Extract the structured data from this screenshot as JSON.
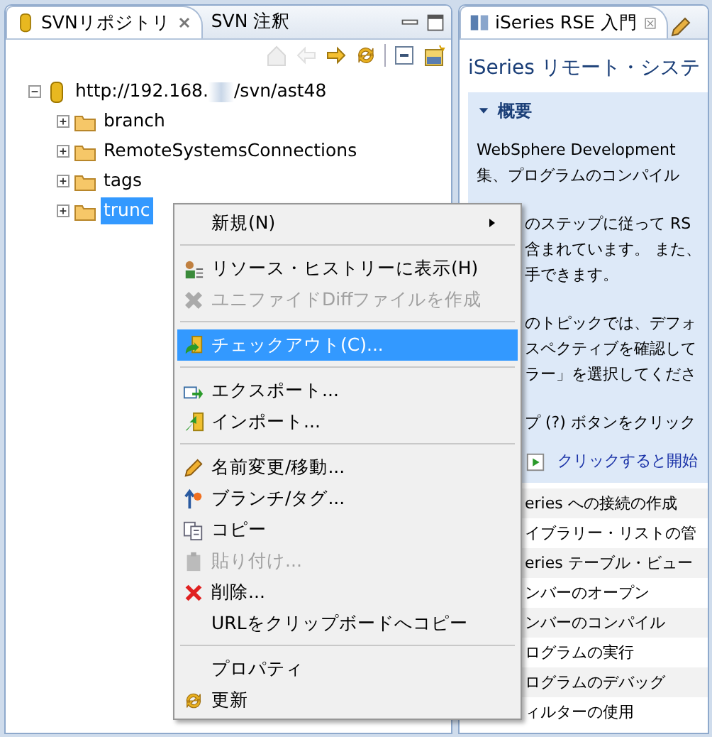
{
  "left_panel": {
    "tabs": [
      {
        "label": "SVNリポジトリ",
        "selected": true,
        "closable": true
      },
      {
        "label": "SVN 注釈",
        "selected": false,
        "closable": false
      }
    ],
    "toolbar": [
      {
        "kind": "home",
        "disabled": true
      },
      {
        "kind": "back",
        "disabled": true
      },
      {
        "kind": "forward",
        "disabled": false
      },
      {
        "kind": "sync",
        "disabled": false
      },
      {
        "kind": "sep"
      },
      {
        "kind": "collapse",
        "disabled": false
      },
      {
        "kind": "svn-new",
        "disabled": false
      }
    ],
    "tree": [
      {
        "label_start": "http://192.168.",
        "label_end": "/svn/ast48",
        "kind": "repo",
        "expanded": true,
        "selected": false,
        "children": [
          {
            "label": "branch",
            "kind": "folder",
            "expanded": false,
            "selected": false
          },
          {
            "label": "RemoteSystemsConnections",
            "kind": "folder",
            "expanded": false,
            "selected": false
          },
          {
            "label": "tags",
            "kind": "folder",
            "expanded": false,
            "selected": false
          },
          {
            "label": "trunc",
            "kind": "folder",
            "expanded": false,
            "selected": true
          }
        ]
      }
    ]
  },
  "right_panel": {
    "tab": {
      "label": "iSeries RSE 入門",
      "selected": true
    },
    "title": "iSeries リモート・システ",
    "section": {
      "heading": "概要",
      "expanded": true,
      "paragraphs": [
        {
          "lines": [
            "WebSphere Development",
            "集、プログラムのコンパイル"
          ],
          "covered": false
        },
        {
          "lines": [
            "のステップに従って RS",
            "含まれています。 また、",
            "手できます。"
          ],
          "covered": true
        },
        {
          "lines": [
            "のトピックでは、デフォ",
            "スペクティブを確認して",
            "ラー」を選択してくださ"
          ],
          "covered": true
        },
        {
          "lines": [
            "プ (?) ボタンをクリック"
          ],
          "covered": true
        }
      ],
      "link": "クリックすると開始"
    },
    "topics": [
      "eries への接続の作成",
      "イブラリー・リストの管",
      "eries テーブル・ビュー",
      "ンバーのオープン",
      "ンバーのコンパイル",
      "ログラムの実行",
      "ログラムのデバッグ",
      "ィルターの使用"
    ]
  },
  "context_menu": [
    {
      "kind": "item",
      "label": "新規(N)",
      "submenu": true,
      "disabled": false,
      "selected": false
    },
    {
      "kind": "separator"
    },
    {
      "kind": "item",
      "label": "リソース・ヒストリーに表示(H)",
      "submenu": false,
      "disabled": false,
      "selected": false
    },
    {
      "kind": "item",
      "label": "ユニファイドDiffファイルを作成",
      "submenu": false,
      "disabled": true,
      "selected": false
    },
    {
      "kind": "separator"
    },
    {
      "kind": "item",
      "label": "チェックアウト(C)...",
      "submenu": false,
      "disabled": false,
      "selected": true
    },
    {
      "kind": "separator"
    },
    {
      "kind": "item",
      "label": "エクスポート...",
      "submenu": false,
      "disabled": false,
      "selected": false
    },
    {
      "kind": "item",
      "label": "インポート...",
      "submenu": false,
      "disabled": false,
      "selected": false
    },
    {
      "kind": "separator"
    },
    {
      "kind": "item",
      "label": "名前変更/移動...",
      "submenu": false,
      "disabled": false,
      "selected": false
    },
    {
      "kind": "item",
      "label": "ブランチ/タグ...",
      "submenu": false,
      "disabled": false,
      "selected": false
    },
    {
      "kind": "item",
      "label": "コピー",
      "submenu": false,
      "disabled": false,
      "selected": false
    },
    {
      "kind": "item",
      "label": "貼り付け...",
      "submenu": false,
      "disabled": true,
      "selected": false
    },
    {
      "kind": "item",
      "label": "削除...",
      "submenu": false,
      "disabled": false,
      "selected": false
    },
    {
      "kind": "item",
      "label": "URLをクリップボードへコピー",
      "submenu": false,
      "disabled": false,
      "selected": false
    },
    {
      "kind": "separator"
    },
    {
      "kind": "item",
      "label": "プロパティ",
      "submenu": false,
      "disabled": false,
      "selected": false
    },
    {
      "kind": "item",
      "label": "更新",
      "submenu": false,
      "disabled": false,
      "selected": false
    }
  ]
}
